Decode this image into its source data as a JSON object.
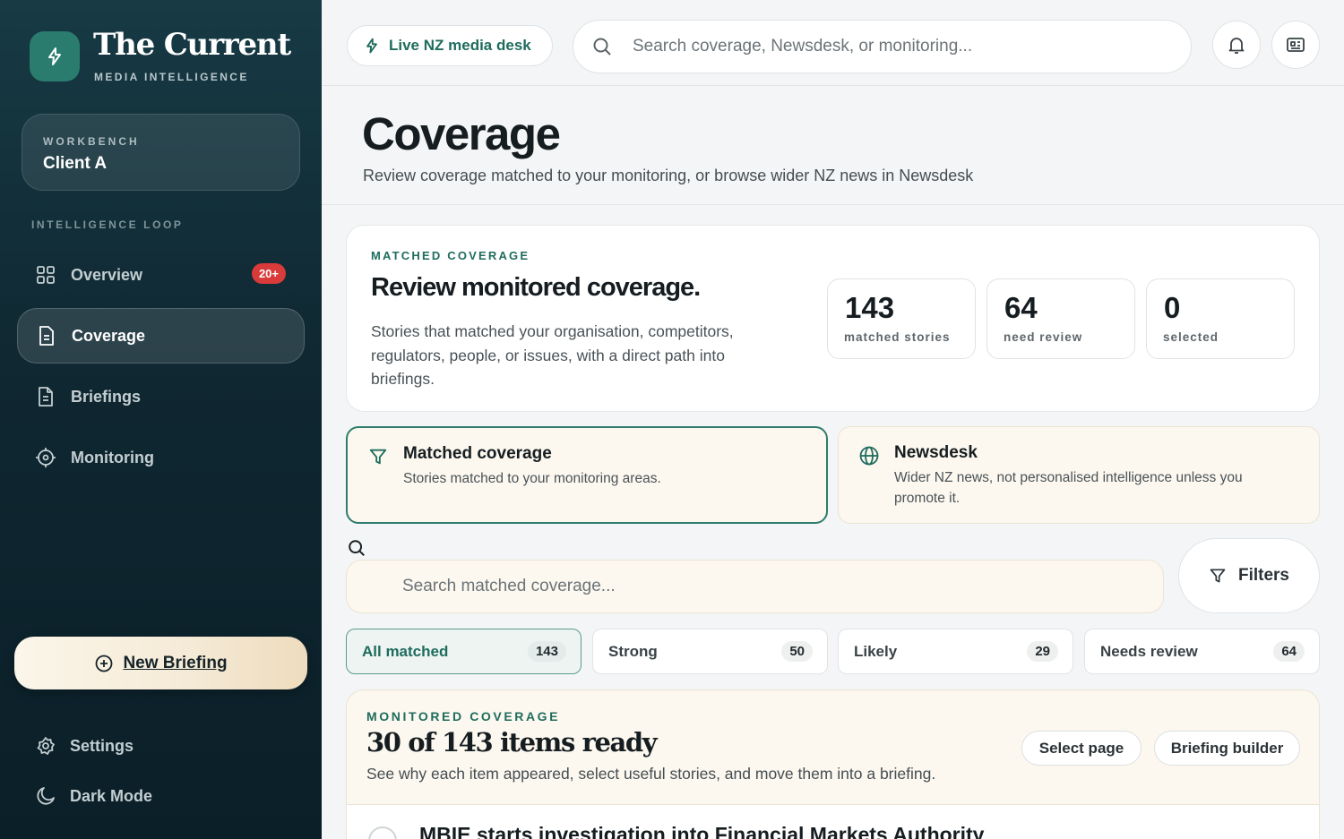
{
  "brand": {
    "name": "The Current",
    "tagline": "MEDIA INTELLIGENCE"
  },
  "workbench": {
    "label": "WORKBENCH",
    "value": "Client A"
  },
  "sidebar": {
    "section_label": "INTELLIGENCE LOOP",
    "items": [
      {
        "label": "Overview",
        "badge": "20+"
      },
      {
        "label": "Coverage"
      },
      {
        "label": "Briefings"
      },
      {
        "label": "Monitoring"
      }
    ],
    "new_briefing": "New Briefing",
    "settings": "Settings",
    "dark_mode": "Dark Mode"
  },
  "topbar": {
    "live_label": "Live NZ media desk",
    "search_placeholder": "Search coverage, Newsdesk, or monitoring..."
  },
  "header": {
    "title": "Coverage",
    "subtitle": "Review coverage matched to your monitoring, or browse wider NZ news in Newsdesk"
  },
  "matched": {
    "eyebrow": "MATCHED COVERAGE",
    "title": "Review monitored coverage.",
    "description": "Stories that matched your organisation, competitors, regulators, people, or issues, with a direct path into briefings.",
    "stats": [
      {
        "value": "143",
        "label": "matched stories"
      },
      {
        "value": "64",
        "label": "need review"
      },
      {
        "value": "0",
        "label": "selected"
      }
    ]
  },
  "modes": [
    {
      "title": "Matched coverage",
      "description": "Stories matched to your monitoring areas."
    },
    {
      "title": "Newsdesk",
      "description": "Wider NZ news, not personalised intelligence unless you promote it."
    }
  ],
  "coverage_search": {
    "placeholder": "Search matched coverage..."
  },
  "filters_label": "Filters",
  "tabs": [
    {
      "label": "All matched",
      "count": "143"
    },
    {
      "label": "Strong",
      "count": "50"
    },
    {
      "label": "Likely",
      "count": "29"
    },
    {
      "label": "Needs review",
      "count": "64"
    }
  ],
  "monitored": {
    "eyebrow": "MONITORED COVERAGE",
    "title": "30 of 143 items ready",
    "description": "See why each item appeared, select useful stories, and move them into a briefing.",
    "select_page": "Select page",
    "briefing_builder": "Briefing builder",
    "first_story": "MBIE starts investigation into Financial Markets Authority"
  },
  "colors": {
    "accent": "#1f6c5d",
    "sidebar": "#0f2731",
    "badge": "#d93a3a",
    "cream": "#fcf8ef"
  }
}
